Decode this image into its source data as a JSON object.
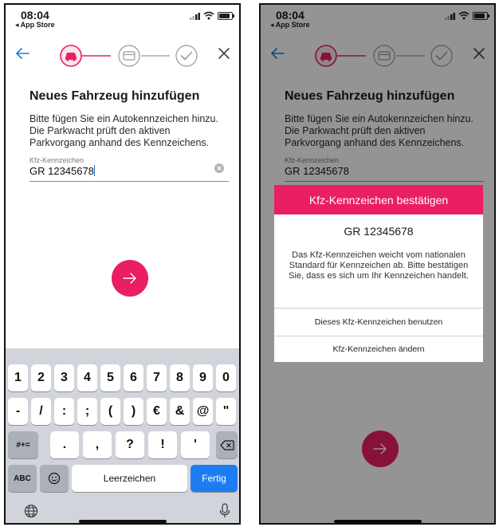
{
  "colors": {
    "accent": "#e91e63",
    "link": "#1f7ad4",
    "keyboard_blue": "#1d7cf2"
  },
  "status_bar": {
    "time": "08:04",
    "back_label": "◂ App Store"
  },
  "icons": {
    "back": "arrow-left-icon",
    "close": "close-icon",
    "step1": "car-icon",
    "step2": "card-icon",
    "step3": "check-icon",
    "clear": "clear-circle-icon",
    "next": "arrow-right-icon",
    "emoji": "emoji-icon",
    "globe": "globe-icon",
    "mic": "microphone-icon",
    "backspace": "backspace-icon"
  },
  "screen": {
    "title": "Neues Fahrzeug hinzufügen",
    "description": "Bitte fügen Sie ein Autokennzeichen hinzu. Die Parkwacht prüft den aktiven Parkvorgang anhand des Kennzeichens.",
    "plate_label": "Kfz-Kennzeichen",
    "plate_value": "GR 12345678"
  },
  "keyboard": {
    "row1": [
      "1",
      "2",
      "3",
      "4",
      "5",
      "6",
      "7",
      "8",
      "9",
      "0"
    ],
    "row2": [
      "-",
      "/",
      ":",
      ";",
      "(",
      ")",
      "€",
      "&",
      "@",
      "\""
    ],
    "row3_left": "#+=",
    "row3": [
      ".",
      ",",
      "?",
      "!",
      "'"
    ],
    "abc": "ABC",
    "space": "Leerzeichen",
    "done": "Fertig"
  },
  "dialog": {
    "title": "Kfz-Kennzeichen bestätigen",
    "plate": "GR 12345678",
    "message": "Das Kfz-Kennzeichen weicht vom nationalen Standard für Kennzeichen ab. Bitte bestätigen Sie, dass es sich um Ihr Kennzeichen handelt.",
    "confirm_label": "Dieses Kfz-Kennzeichen benutzen",
    "change_label": "Kfz-Kennzeichen ändern"
  }
}
